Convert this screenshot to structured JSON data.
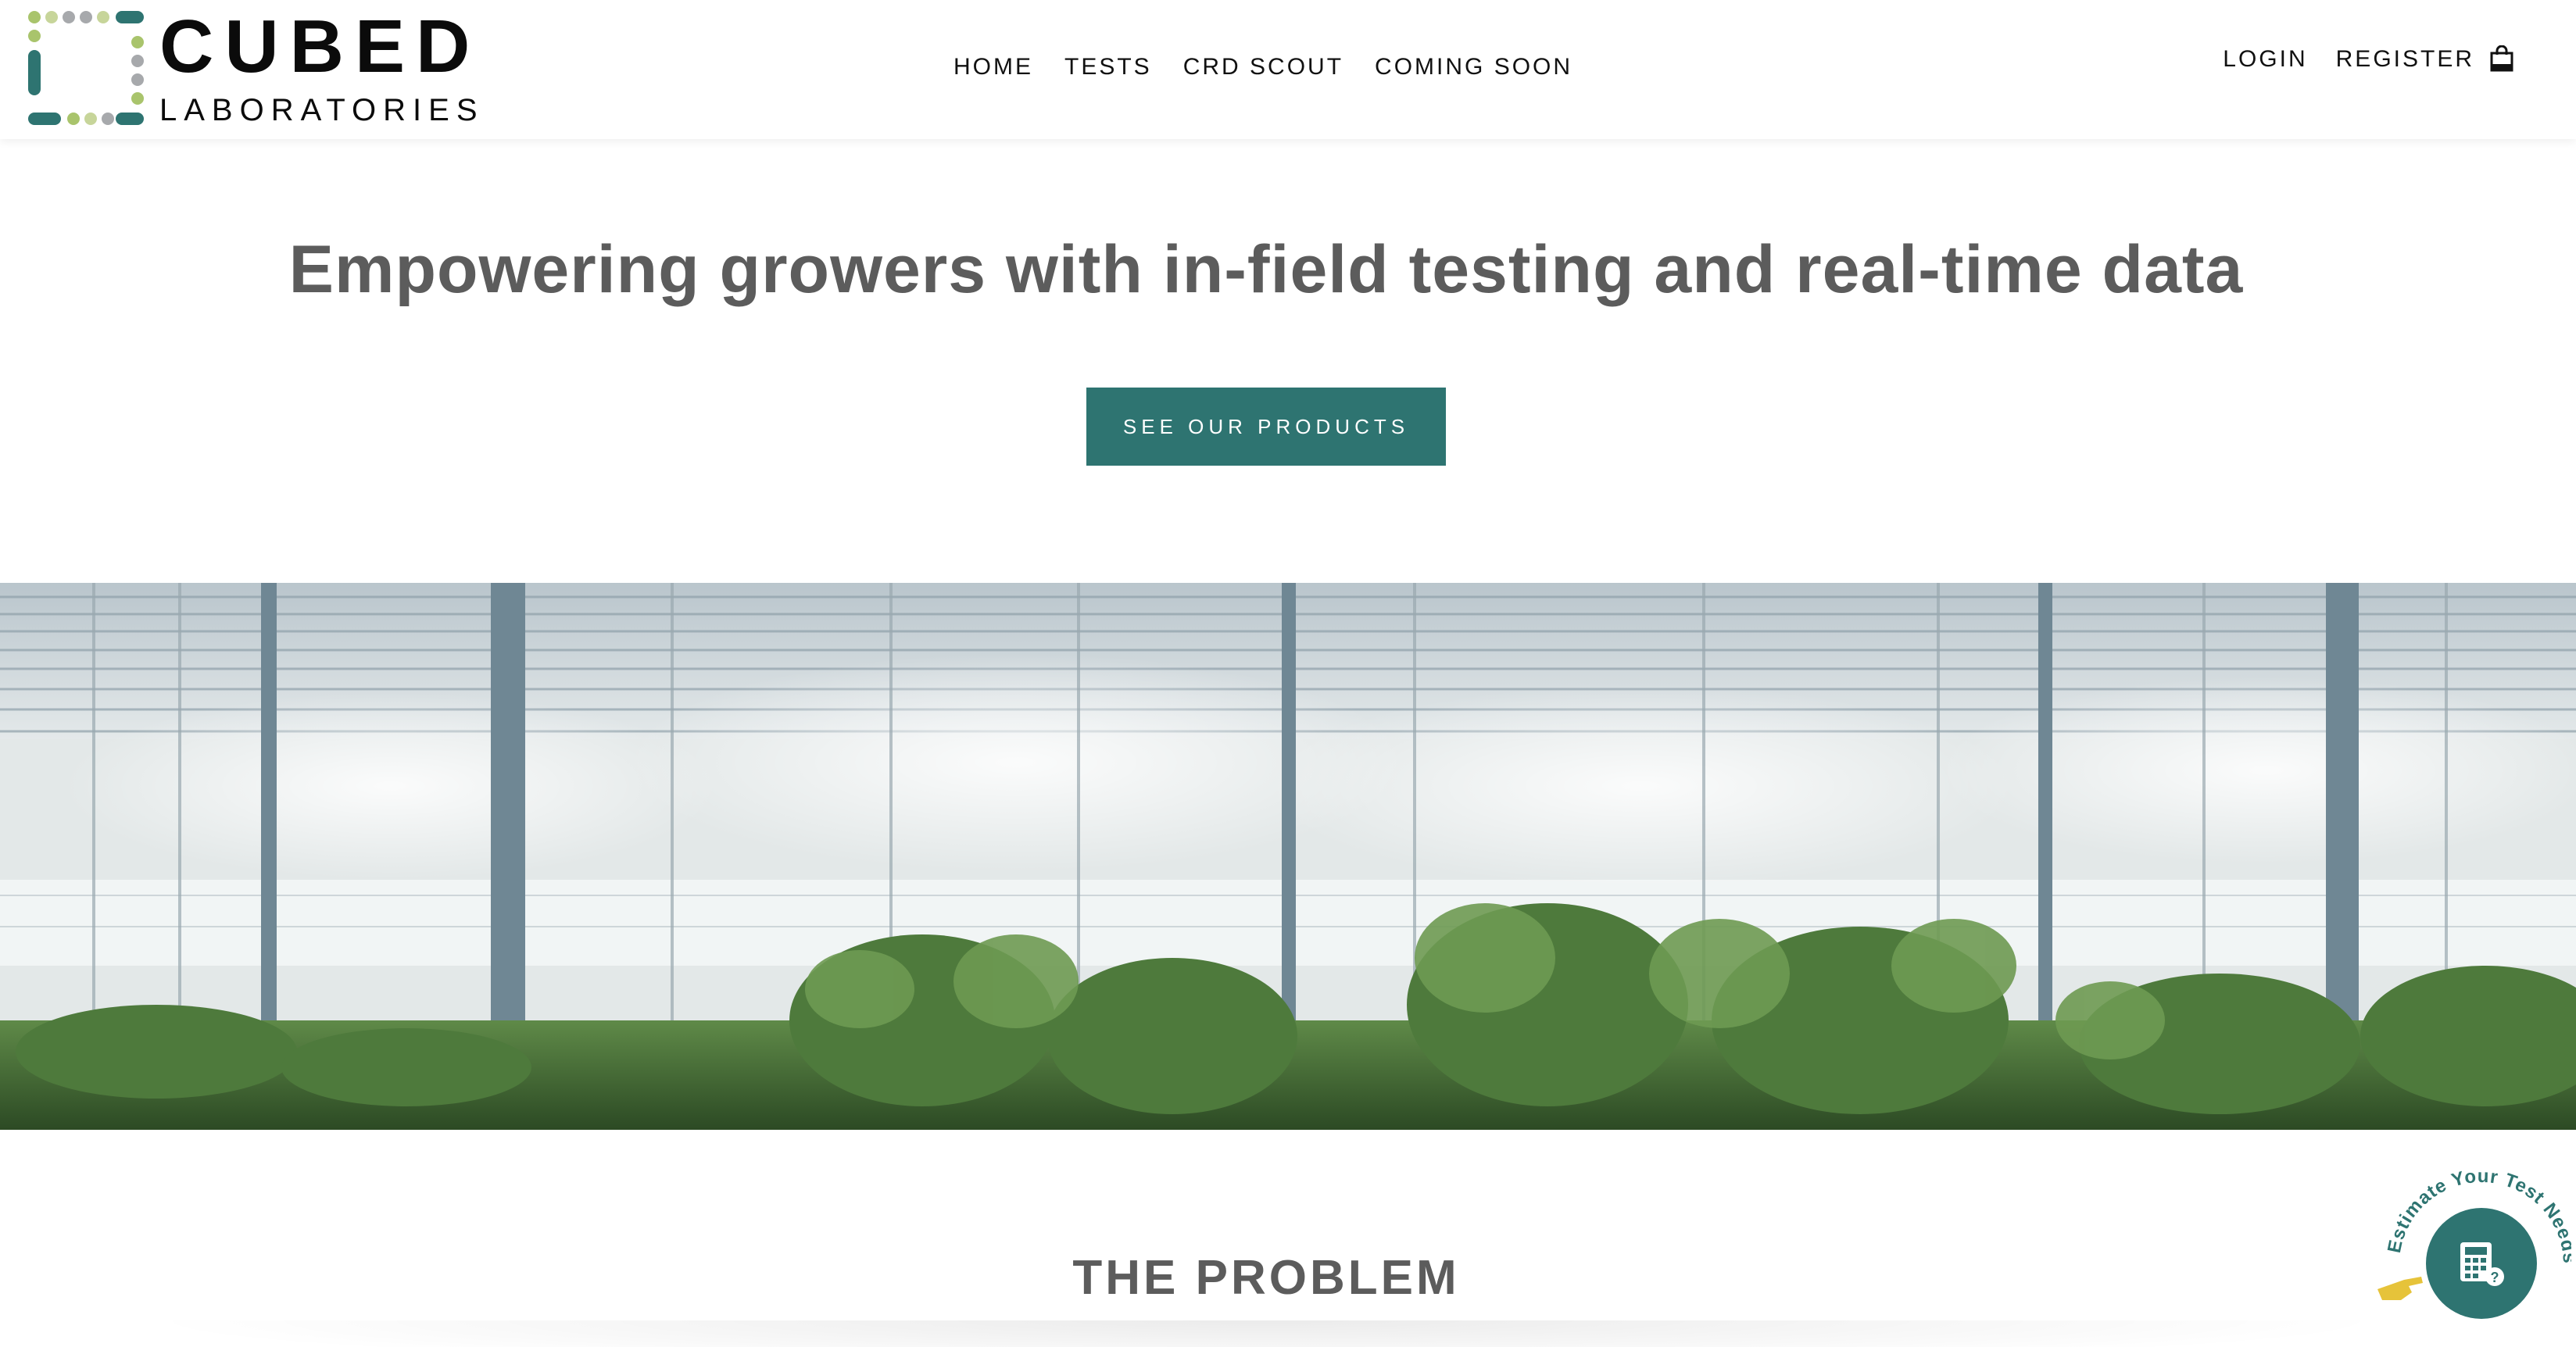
{
  "brand": {
    "name_line1": "CUBED",
    "name_line2": "LABORATORIES",
    "colors": {
      "teal": "#2e7471",
      "light_green": "#a9c46c",
      "gray": "#a7a9ac",
      "heading_gray": "#5c5c5c"
    }
  },
  "nav": {
    "items": [
      {
        "label": "HOME"
      },
      {
        "label": "TESTS"
      },
      {
        "label": "CRD SCOUT"
      },
      {
        "label": "COMING SOON"
      }
    ]
  },
  "account": {
    "login_label": "LOGIN",
    "register_label": "REGISTER",
    "cart_icon": "shopping-bag-icon"
  },
  "hero": {
    "title": "Empowering growers with in-field testing and real-time data",
    "cta_label": "SEE OUR PRODUCTS"
  },
  "banner": {
    "image_icon": "greenhouse-photo"
  },
  "problem": {
    "title": "THE PROBLEM"
  },
  "estimate_widget": {
    "label": "Estimate Your Test Needs",
    "icon": "calculator-icon",
    "pointer_icon": "pointing-hand-icon"
  }
}
